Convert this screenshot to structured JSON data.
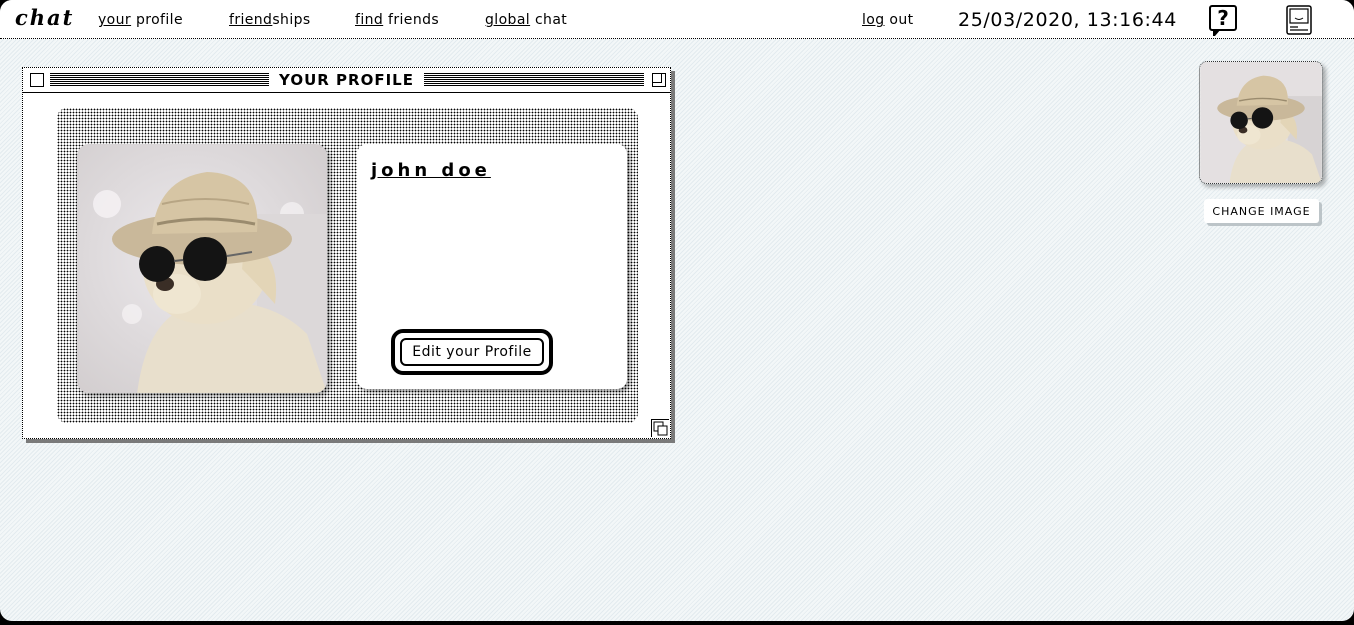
{
  "menu": {
    "logo": "chat",
    "nav": [
      {
        "underlined": "your",
        "rest": " profile"
      },
      {
        "underlined": "friend",
        "rest": "ships"
      },
      {
        "underlined": "find",
        "rest": " friends"
      },
      {
        "underlined": "global",
        "rest": " chat"
      },
      {
        "underlined": "log",
        "rest": " out"
      }
    ],
    "clock": "25/03/2020, 13:16:44",
    "help_icon": "?"
  },
  "profile_window": {
    "title": "YOUR PROFILE",
    "user_name": "john doe",
    "edit_button": "Edit your Profile"
  },
  "avatar_panel": {
    "change_image_button": "CHANGE IMAGE"
  },
  "icons": {
    "help": "question-bubble-icon",
    "computer": "macintosh-computer-icon"
  }
}
